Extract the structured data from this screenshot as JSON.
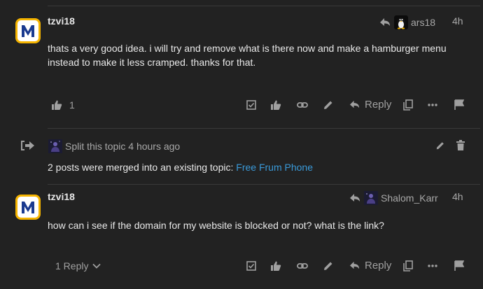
{
  "posts": [
    {
      "username": "tzvi18",
      "reply_to": "ars18",
      "time": "4h",
      "body": "thats a very good idea. i will try and remove what is there now and make a hamburger menu instead to make it less cramped. thanks for that.",
      "likes": "1",
      "reply_label": "Reply"
    },
    {
      "username": "tzvi18",
      "reply_to": "Shalom_Karr",
      "time": "4h",
      "body": "how can i see if the domain for my website is blocked or not? what is the link?",
      "replies_label": "1 Reply",
      "reply_label": "Reply"
    }
  ],
  "small_action": {
    "action_text": "Split this topic 4 hours ago",
    "message_prefix": "2 posts were merged into an existing topic:",
    "link_text": "Free Frum Phone"
  },
  "colors": {
    "background": "#222222",
    "avatar_yellow": "#f5b400",
    "avatar_blue": "#1a3a8f",
    "link": "#3a9ad9",
    "muted": "#a0a0a0"
  }
}
